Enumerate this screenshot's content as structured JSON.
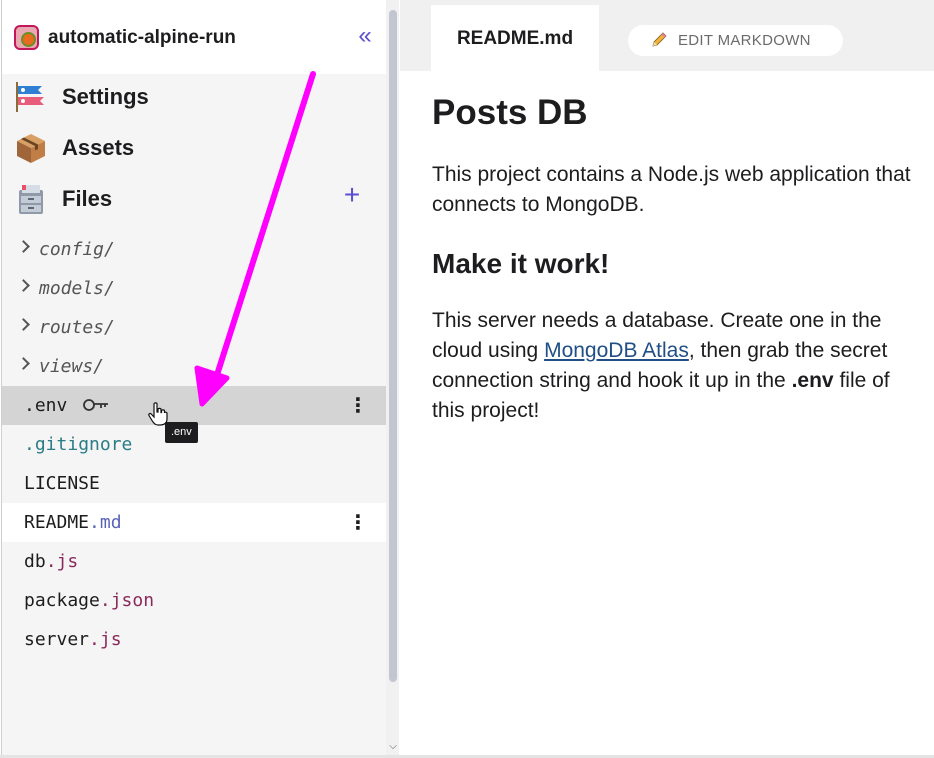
{
  "project": {
    "name": "automatic-alpine-run",
    "collapse_label": "«"
  },
  "sections": {
    "settings": "Settings",
    "assets": "Assets",
    "files": "Files",
    "add_label": "+"
  },
  "files": {
    "folders": [
      "config/",
      "models/",
      "routes/",
      "views/"
    ],
    "env": {
      "name": ".env"
    },
    "gitignore": {
      "base": ".",
      "ext": "gitignore"
    },
    "license": {
      "name": "LICENSE"
    },
    "readme": {
      "base": "README",
      "ext": ".md"
    },
    "db": {
      "base": "db",
      "ext": ".js"
    },
    "package": {
      "base": "package",
      "ext": ".json"
    },
    "server": {
      "base": "server",
      "ext": ".js"
    },
    "kebab": "⋮",
    "tooltip": ".env"
  },
  "tabs": {
    "active": "README.md",
    "edit": "EDIT MARKDOWN"
  },
  "readme": {
    "title": "Posts DB",
    "intro": "This project contains a Node.js web application that connects to MongoDB.",
    "subtitle": "Make it work!",
    "body_before": "This server needs a database. Create one in the cloud using ",
    "link_text": "MongoDB Atlas",
    "body_middle": ", then grab the secret connection string and hook it up in the ",
    "env_bold": ".env",
    "body_after": " file of this project!"
  },
  "colors": {
    "accent": "#5a4fcf",
    "annotation_arrow": "#ff00ff",
    "link": "#1f4f86"
  }
}
